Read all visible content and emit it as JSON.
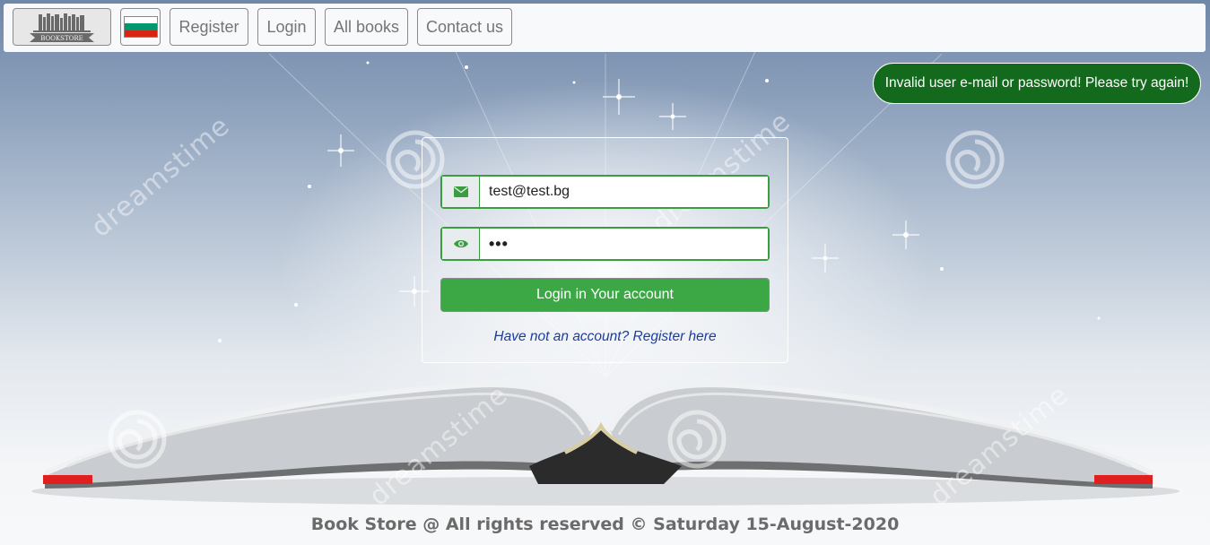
{
  "nav": {
    "logo_text": "BOOKSTORE",
    "flag_colors": [
      "#ffffff",
      "#00966e",
      "#d62612"
    ],
    "items": [
      {
        "label": "Register"
      },
      {
        "label": "Login"
      },
      {
        "label": "All books"
      },
      {
        "label": "Contact us"
      }
    ]
  },
  "alert": {
    "message": "Invalid user e-mail or password! Please try again!",
    "color": "#146a1c"
  },
  "login": {
    "email_value": "test@test.bg",
    "password_value": "•••",
    "email_icon": "envelope-icon",
    "password_icon": "eye-icon",
    "submit_label": "Login in Your account",
    "register_link": "Have not an account? Register here",
    "accent_color": "#3ca845"
  },
  "background": {
    "watermark_text": "dreamstime"
  },
  "footer": {
    "text": "Book Store @ All rights reserved © Saturday 15-August-2020"
  }
}
